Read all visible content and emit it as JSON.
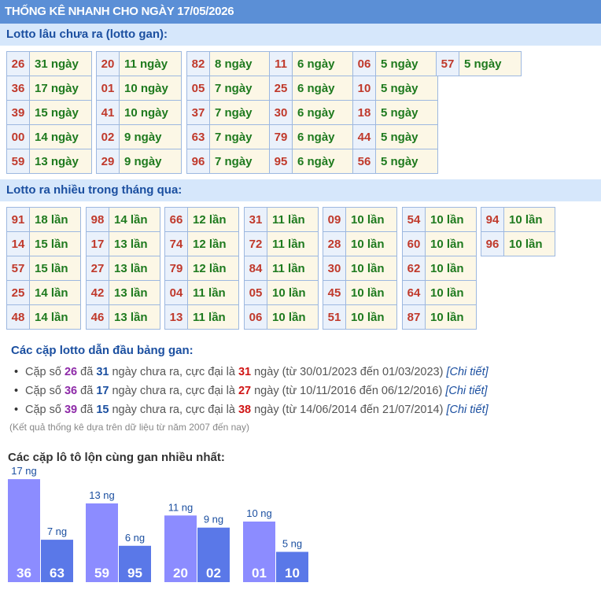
{
  "header": {
    "title": "THỐNG KÊ NHANH CHO NGÀY 17/05/2026"
  },
  "gan_section": {
    "title": "Lotto lâu chưa ra (lotto gan):",
    "tables": [
      [
        [
          "26",
          "31 ngày"
        ],
        [
          "36",
          "17 ngày"
        ],
        [
          "39",
          "15 ngày"
        ],
        [
          "00",
          "14 ngày"
        ],
        [
          "59",
          "13 ngày"
        ]
      ],
      [
        [
          "20",
          "11 ngày"
        ],
        [
          "01",
          "10 ngày"
        ],
        [
          "41",
          "10 ngày"
        ],
        [
          "02",
          "9 ngày"
        ],
        [
          "29",
          "9 ngày"
        ]
      ],
      [
        [
          "82",
          "8 ngày"
        ],
        [
          "05",
          "7 ngày"
        ],
        [
          "37",
          "7 ngày"
        ],
        [
          "63",
          "7 ngày"
        ],
        [
          "96",
          "7 ngày"
        ]
      ],
      [
        [
          "11",
          "6 ngày"
        ],
        [
          "25",
          "6 ngày"
        ],
        [
          "30",
          "6 ngày"
        ],
        [
          "79",
          "6 ngày"
        ],
        [
          "95",
          "6 ngày"
        ]
      ],
      [
        [
          "06",
          "5 ngày"
        ],
        [
          "10",
          "5 ngày"
        ],
        [
          "18",
          "5 ngày"
        ],
        [
          "44",
          "5 ngày"
        ],
        [
          "56",
          "5 ngày"
        ]
      ],
      [
        [
          "57",
          "5 ngày"
        ]
      ]
    ]
  },
  "freq_section": {
    "title": "Lotto ra nhiều trong tháng qua:",
    "tables": [
      [
        [
          "91",
          "18 lần"
        ],
        [
          "14",
          "15 lần"
        ],
        [
          "57",
          "15 lần"
        ],
        [
          "25",
          "14 lần"
        ],
        [
          "48",
          "14 lần"
        ]
      ],
      [
        [
          "98",
          "14 lần"
        ],
        [
          "17",
          "13 lần"
        ],
        [
          "27",
          "13 lần"
        ],
        [
          "42",
          "13 lần"
        ],
        [
          "46",
          "13 lần"
        ]
      ],
      [
        [
          "66",
          "12 lần"
        ],
        [
          "74",
          "12 lần"
        ],
        [
          "79",
          "12 lần"
        ],
        [
          "04",
          "11 lần"
        ],
        [
          "13",
          "11 lần"
        ]
      ],
      [
        [
          "31",
          "11 lần"
        ],
        [
          "72",
          "11 lần"
        ],
        [
          "84",
          "11 lần"
        ],
        [
          "05",
          "10 lần"
        ],
        [
          "06",
          "10 lần"
        ]
      ],
      [
        [
          "09",
          "10 lần"
        ],
        [
          "28",
          "10 lần"
        ],
        [
          "30",
          "10 lần"
        ],
        [
          "45",
          "10 lần"
        ],
        [
          "51",
          "10 lần"
        ]
      ],
      [
        [
          "54",
          "10 lần"
        ],
        [
          "60",
          "10 lần"
        ],
        [
          "62",
          "10 lần"
        ],
        [
          "64",
          "10 lần"
        ],
        [
          "87",
          "10 lần"
        ]
      ],
      [
        [
          "94",
          "10 lần"
        ],
        [
          "96",
          "10 lần"
        ]
      ]
    ]
  },
  "pairs": {
    "title": "Các cặp lotto dẫn đầu bảng gan:",
    "items": [
      {
        "t1": "Cặp số ",
        "num": "26",
        "t2": " đã ",
        "days": "31",
        "t3": " ngày chưa ra, cực đại là ",
        "max": "31",
        "t4": " ngày (từ 30/01/2023 đến 01/03/2023) ",
        "link": "[Chi tiết]"
      },
      {
        "t1": "Cặp số ",
        "num": "36",
        "t2": " đã ",
        "days": "17",
        "t3": " ngày chưa ra, cực đại là ",
        "max": "27",
        "t4": " ngày (từ 10/11/2016 đến 06/12/2016) ",
        "link": "[Chi tiết]"
      },
      {
        "t1": "Cặp số ",
        "num": "39",
        "t2": " đã ",
        "days": "15",
        "t3": " ngày chưa ra, cực đại là ",
        "max": "38",
        "t4": " ngày (từ 14/06/2014 đến 21/07/2014) ",
        "link": "[Chi tiết]"
      }
    ],
    "note": "(Kết quả thống kê dựa trên dữ liệu từ năm 2007 đến nay)"
  },
  "chart_section": {
    "title": "Các cặp lô tô lộn cùng gan nhiều nhất:"
  },
  "colors": {
    "bar_a": "#8c8cff",
    "bar_b": "#5a78e8",
    "header_bg": "#5b8fd6",
    "section_bg": "#d6e7fb"
  },
  "chart_data": {
    "type": "bar",
    "unit_suffix": " ng",
    "groups": [
      {
        "bars": [
          {
            "label": "36",
            "value": 17
          },
          {
            "label": "63",
            "value": 7
          }
        ]
      },
      {
        "bars": [
          {
            "label": "59",
            "value": 13
          },
          {
            "label": "95",
            "value": 6
          }
        ]
      },
      {
        "bars": [
          {
            "label": "20",
            "value": 11
          },
          {
            "label": "02",
            "value": 9
          }
        ]
      },
      {
        "bars": [
          {
            "label": "01",
            "value": 10
          },
          {
            "label": "10",
            "value": 5
          }
        ]
      }
    ]
  }
}
